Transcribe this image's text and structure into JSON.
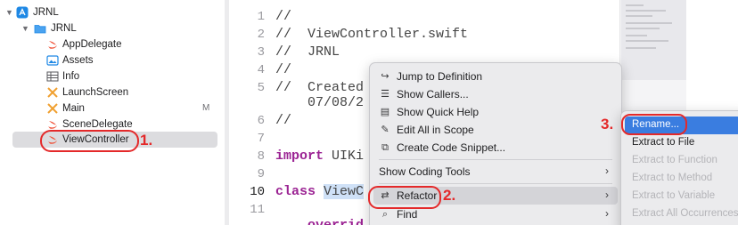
{
  "navigator": {
    "project": "JRNL",
    "group": "JRNL",
    "files": [
      "AppDelegate",
      "Assets",
      "Info",
      "LaunchScreen",
      "Main",
      "SceneDelegate",
      "ViewController"
    ],
    "main_badge": "M"
  },
  "annotations": [
    "1.",
    "2.",
    "3."
  ],
  "editor": {
    "line_numbers": [
      "1",
      "2",
      "3",
      "4",
      "5",
      "6",
      "7",
      "8",
      "9",
      "10",
      "11"
    ],
    "l1": "//",
    "l2": "//  ViewController.swift",
    "l3": "//  JRNL",
    "l4": "//",
    "l5": "//  Created",
    "l5b": "07/08/2",
    "l6": "//",
    "l8_kw": "import",
    "l8_rest": " UIKi",
    "l10_kw": "class",
    "l10_sel": "ViewC",
    "l12": "overrid"
  },
  "context_menu": {
    "jump": "Jump to Definition",
    "callers": "Show Callers...",
    "quick_help": "Show Quick Help",
    "edit_scope": "Edit All in Scope",
    "snippet": "Create Code Snippet...",
    "coding_tools": "Show Coding Tools",
    "refactor": "Refactor",
    "find": "Find"
  },
  "refactor_submenu": {
    "rename": "Rename...",
    "extract_file": "Extract to File",
    "extract_function": "Extract to Function",
    "extract_method": "Extract to Method",
    "extract_variable": "Extract to Variable",
    "extract_all": "Extract All Occurrences"
  },
  "colors": {
    "accent_red": "#e4292a",
    "keyword": "#9b2393",
    "folder_blue": "#1e88e5",
    "swift_orange": "#f05138",
    "selection_blue": "#3a7de0"
  }
}
